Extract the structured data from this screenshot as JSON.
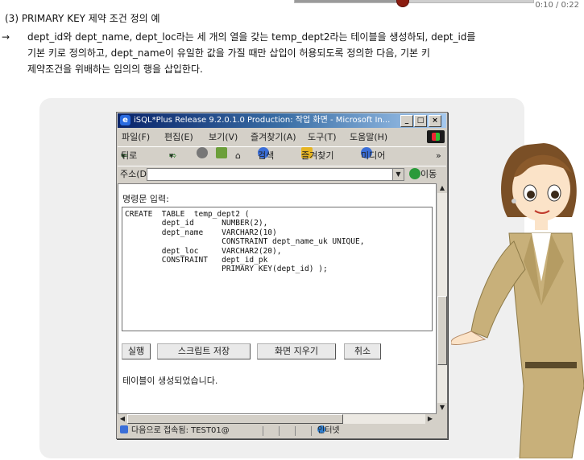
{
  "player": {
    "time": "0:10 / 0:22",
    "progress": 0.45
  },
  "lesson": {
    "heading": "(3) PRIMARY KEY 제약 조건 정의 예",
    "arrow": "→",
    "desc_line1": "dept_id와 dept_name, dept_loc라는 세 개의 열을 갖는 temp_dept2라는 테이블을 생성하되, dept_id를",
    "desc_line2": "기본 키로 정의하고, dept_name이 유일한 값을 가질 때만 삽입이 허용되도록 정의한 다음, 기본 키",
    "desc_line3": "제약조건을 위배하는 임의의 행을 삽입한다."
  },
  "window": {
    "title": "iSQL*Plus Release 9.2.0.1.0 Production: 작업 화면 - Microsoft In...",
    "minimize": "_",
    "maximize": "□",
    "close": "×",
    "menu": [
      "파일(F)",
      "편집(E)",
      "보기(V)",
      "즐겨찾기(A)",
      "도구(T)",
      "도움말(H)"
    ],
    "toolbar": {
      "back": "뒤로",
      "search": "검색",
      "favorites": "즐겨찾기",
      "media": "미디어",
      "more": "»"
    },
    "address_label": "주소(D)",
    "address_value": "",
    "go": "이동"
  },
  "isql": {
    "command_label": "명령문 입력:",
    "sql": "CREATE  TABLE  temp_dept2 (\n        dept_id      NUMBER(2),\n        dept_name    VARCHAR2(10)\n                     CONSTRAINT dept_name_uk UNIQUE,\n        dept_loc     VARCHAR2(20),\n        CONSTRAINT   dept_id_pk\n                     PRIMARY KEY(dept_id) );",
    "buttons": {
      "execute": "실행",
      "save_script": "스크립트 저장",
      "clear_screen": "화면 지우기",
      "cancel": "취소"
    },
    "result": "테이블이 생성되었습니다."
  },
  "statusbar": {
    "text": "다음으로 접속됨: TEST01@",
    "zone": "인터넷"
  }
}
